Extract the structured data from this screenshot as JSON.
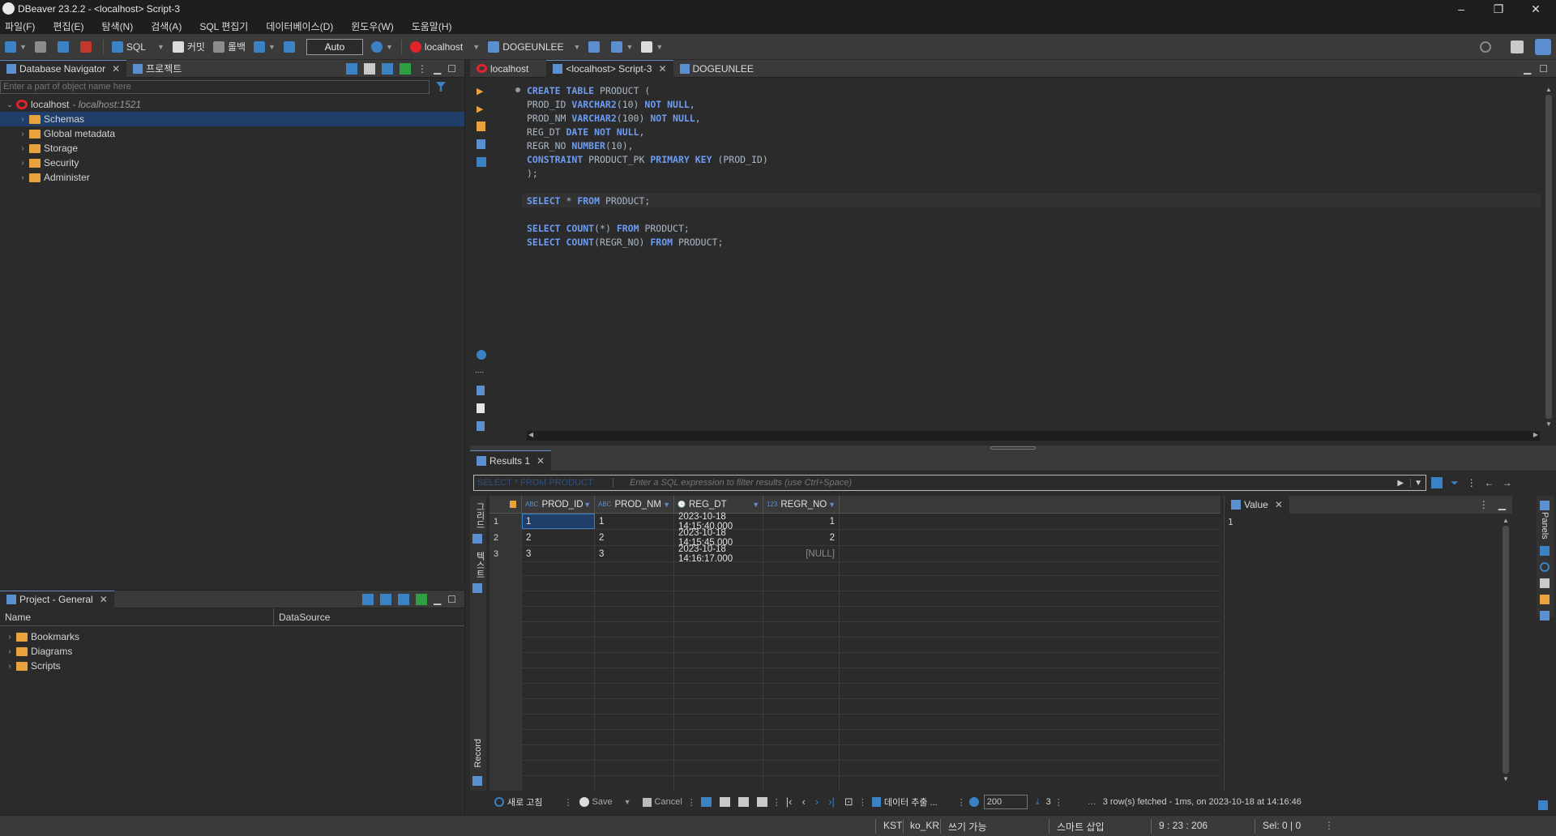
{
  "window": {
    "title": "DBeaver 23.2.2 - <localhost> Script-3",
    "minimize": "–",
    "restore": "❐",
    "close": "✕"
  },
  "menu": [
    "파일(F)",
    "편집(E)",
    "탐색(N)",
    "검색(A)",
    "SQL 편집기",
    "데이터베이스(D)",
    "윈도우(W)",
    "도움말(H)"
  ],
  "toolbar": {
    "sql_label": "SQL",
    "commit_label": "커밋",
    "rollback_label": "롤백",
    "transaction_mode": "Auto",
    "connection_label": "localhost",
    "schema_label": "DOGEUNLEE"
  },
  "navigator": {
    "tab_label": "Database Navigator",
    "project_tab_label": "프로젝트",
    "filter_placeholder": "Enter a part of object name here",
    "connection_name": "localhost",
    "connection_host": " - localhost:1521",
    "nodes": [
      "Schemas",
      "Global metadata",
      "Storage",
      "Security",
      "Administer"
    ]
  },
  "project": {
    "tab_label": "Project - General",
    "col_name": "Name",
    "col_datasource": "DataSource",
    "items": [
      "Bookmarks",
      "Diagrams",
      "Scripts"
    ]
  },
  "editor_tabs": {
    "tab1": "localhost",
    "tab2": "<localhost> Script-3",
    "tab3": "DOGEUNLEE"
  },
  "sql_lines": [
    [
      {
        "t": "CREATE",
        "k": 1
      },
      {
        "t": " "
      },
      {
        "t": "TABLE",
        "k": 1
      },
      {
        "t": " PRODUCT ("
      }
    ],
    [
      {
        "t": "PROD_ID "
      },
      {
        "t": "VARCHAR2",
        "k": 1
      },
      {
        "t": "(10) "
      },
      {
        "t": "NOT NULL",
        "k": 1
      },
      {
        "t": ","
      }
    ],
    [
      {
        "t": "PROD_NM "
      },
      {
        "t": "VARCHAR2",
        "k": 1
      },
      {
        "t": "(100) "
      },
      {
        "t": "NOT NULL",
        "k": 1
      },
      {
        "t": ","
      }
    ],
    [
      {
        "t": "REG_DT "
      },
      {
        "t": "DATE",
        "k": 1
      },
      {
        "t": " "
      },
      {
        "t": "NOT NULL",
        "k": 1
      },
      {
        "t": ","
      }
    ],
    [
      {
        "t": "REGR_NO "
      },
      {
        "t": "NUMBER",
        "k": 1
      },
      {
        "t": "(10),"
      }
    ],
    [
      {
        "t": "CONSTRAINT",
        "k": 1
      },
      {
        "t": " PRODUCT_PK "
      },
      {
        "t": "PRIMARY KEY",
        "k": 1
      },
      {
        "t": " (PROD_ID)"
      }
    ],
    [
      {
        "t": ");"
      }
    ],
    [],
    [
      {
        "t": "SELECT",
        "k": 1
      },
      {
        "t": " * "
      },
      {
        "t": "FROM",
        "k": 1
      },
      {
        "t": " PRODUCT;"
      }
    ],
    [],
    [
      {
        "t": "SELECT",
        "k": 1
      },
      {
        "t": " "
      },
      {
        "t": "COUNT",
        "k": 1
      },
      {
        "t": "(*) "
      },
      {
        "t": "FROM",
        "k": 1
      },
      {
        "t": " PRODUCT;"
      }
    ],
    [
      {
        "t": "SELECT",
        "k": 1
      },
      {
        "t": " "
      },
      {
        "t": "COUNT",
        "k": 1
      },
      {
        "t": "(REGR_NO) "
      },
      {
        "t": "FROM",
        "k": 1
      },
      {
        "t": " PRODUCT;"
      }
    ]
  ],
  "results": {
    "tab_label": "Results 1",
    "query_label": "SELECT * FROM PRODUCT",
    "filter_placeholder": "Enter a SQL expression to filter results (use Ctrl+Space)",
    "columns": [
      {
        "type": "ABC",
        "name": "PROD_ID"
      },
      {
        "type": "ABC",
        "name": "PROD_NM"
      },
      {
        "type": "🕓",
        "name": "REG_DT"
      },
      {
        "type": "123",
        "name": "REGR_NO"
      }
    ],
    "rows": [
      {
        "num": "1",
        "prod_id": "1",
        "prod_nm": "1",
        "reg_dt": "2023-10-18 14:15:40.000",
        "regr_no": "1"
      },
      {
        "num": "2",
        "prod_id": "2",
        "prod_nm": "2",
        "reg_dt": "2023-10-18 14:15:45.000",
        "regr_no": "2"
      },
      {
        "num": "3",
        "prod_id": "3",
        "prod_nm": "3",
        "reg_dt": "2023-10-18 14:16:17.000",
        "regr_no": "[NULL]"
      }
    ],
    "value_panel_label": "Value",
    "value_content": "1",
    "side_labels": {
      "grid": "그리드",
      "text": "텍스트",
      "record": "Record",
      "panels": "Panels"
    },
    "bottom": {
      "refresh": "새로 고침",
      "save": "Save",
      "cancel": "Cancel",
      "export": "데이터 추출 ...",
      "fetch_size": "200",
      "row_count": "3",
      "status": "3 row(s) fetched - 1ms, on 2023-10-18 at 14:16:46"
    }
  },
  "statusbar": {
    "timezone": "KST",
    "locale": "ko_KR",
    "writable": "쓰기 가능",
    "insert_mode": "스마트 삽입",
    "position": "9 : 23 : 206",
    "selection": "Sel: 0 | 0"
  },
  "colors": {
    "keyword": "#6e9cf2",
    "identifier": "#a9b7c6",
    "folder": "#e8a33c",
    "oracle_red": "#e0242a",
    "selection": "#1f3f6a"
  }
}
